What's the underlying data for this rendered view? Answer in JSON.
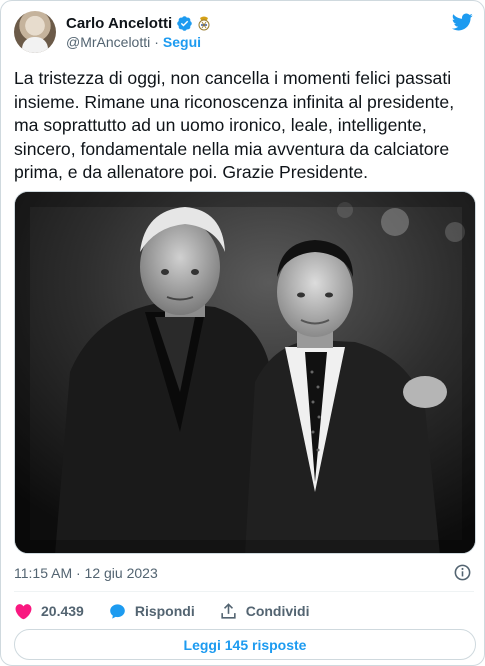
{
  "tweet": {
    "author": {
      "name": "Carlo Ancelotti",
      "handle": "@MrAncelotti",
      "separator": "·",
      "follow_label": "Segui"
    },
    "text": "La tristezza di oggi, non cancella i momenti felici passati insieme. Rimane una riconoscenza infinita al presidente, ma soprattutto ad un uomo ironico, leale, intelligente, sincero, fondamentale nella mia avventura da calciatore prima, e da allenatore poi. Grazie Presidente.",
    "timestamp": "11:15 AM · 12 giu 2023",
    "actions": {
      "like_count": "20.439",
      "reply_label": "Rispondi",
      "share_label": "Condividi"
    },
    "read_replies_label": "Leggi 145 risposte"
  },
  "colors": {
    "accent": "#1d9bf0",
    "like": "#f91880",
    "muted": "#536471",
    "text": "#0f1419"
  },
  "icons": [
    "verified-badge-icon",
    "real-madrid-crest-icon",
    "twitter-bird-icon",
    "info-icon",
    "heart-icon",
    "reply-bubble-icon",
    "share-icon"
  ]
}
